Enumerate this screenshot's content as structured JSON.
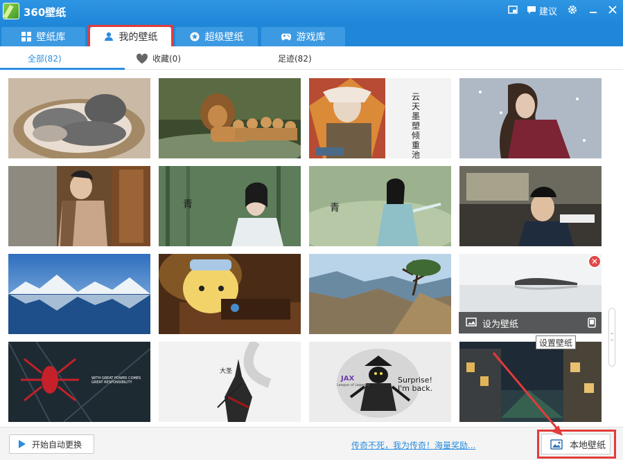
{
  "app": {
    "title": "360壁纸",
    "suggest_label": "建议"
  },
  "tabs": [
    {
      "label": "壁纸库",
      "icon": "grid-icon"
    },
    {
      "label": "我的壁纸",
      "icon": "user-icon",
      "active": true
    },
    {
      "label": "超级壁纸",
      "icon": "star-icon"
    },
    {
      "label": "游戏库",
      "icon": "gamepad-icon"
    }
  ],
  "subtabs": [
    {
      "label": "全部(82)",
      "active": true
    },
    {
      "label": "收藏(0)",
      "icon": "heart-icon"
    },
    {
      "label": "足迹(82)"
    }
  ],
  "thumbnails": [
    {
      "subject": "cats"
    },
    {
      "subject": "lions"
    },
    {
      "subject": "warrior",
      "caption": "云天墨塑倾重池"
    },
    {
      "subject": "woman-in-snow"
    },
    {
      "subject": "man-at-window"
    },
    {
      "subject": "woman-in-forest"
    },
    {
      "subject": "woman-swordfighter"
    },
    {
      "subject": "man-in-car"
    },
    {
      "subject": "mountain-lake"
    },
    {
      "subject": "cartoon-bear"
    },
    {
      "subject": "canyon-tree"
    },
    {
      "subject": "misty-lake",
      "hover": true
    },
    {
      "subject": "spider-logo",
      "caption": "WITH GREAT POWER COMES GREAT RESPONSIBILITY"
    },
    {
      "subject": "ink-figure",
      "caption": "大圣"
    },
    {
      "subject": "jax",
      "caption_left": "JAX",
      "caption_sub": "League of Legends",
      "caption_right": "Surprise! I'm back."
    },
    {
      "subject": "night-street"
    }
  ],
  "overlay": {
    "set_wallpaper_label": "设为壁纸",
    "tooltip": "设置壁纸"
  },
  "footer": {
    "auto_change_label": "开始自动更换",
    "promo_link": "传奇不死，我为传奇！海量奖励...",
    "local_wallpaper_label": "本地壁纸"
  },
  "colors": {
    "accent": "#1f86d8",
    "link": "#2b8de0",
    "highlight": "#e23b3b"
  }
}
